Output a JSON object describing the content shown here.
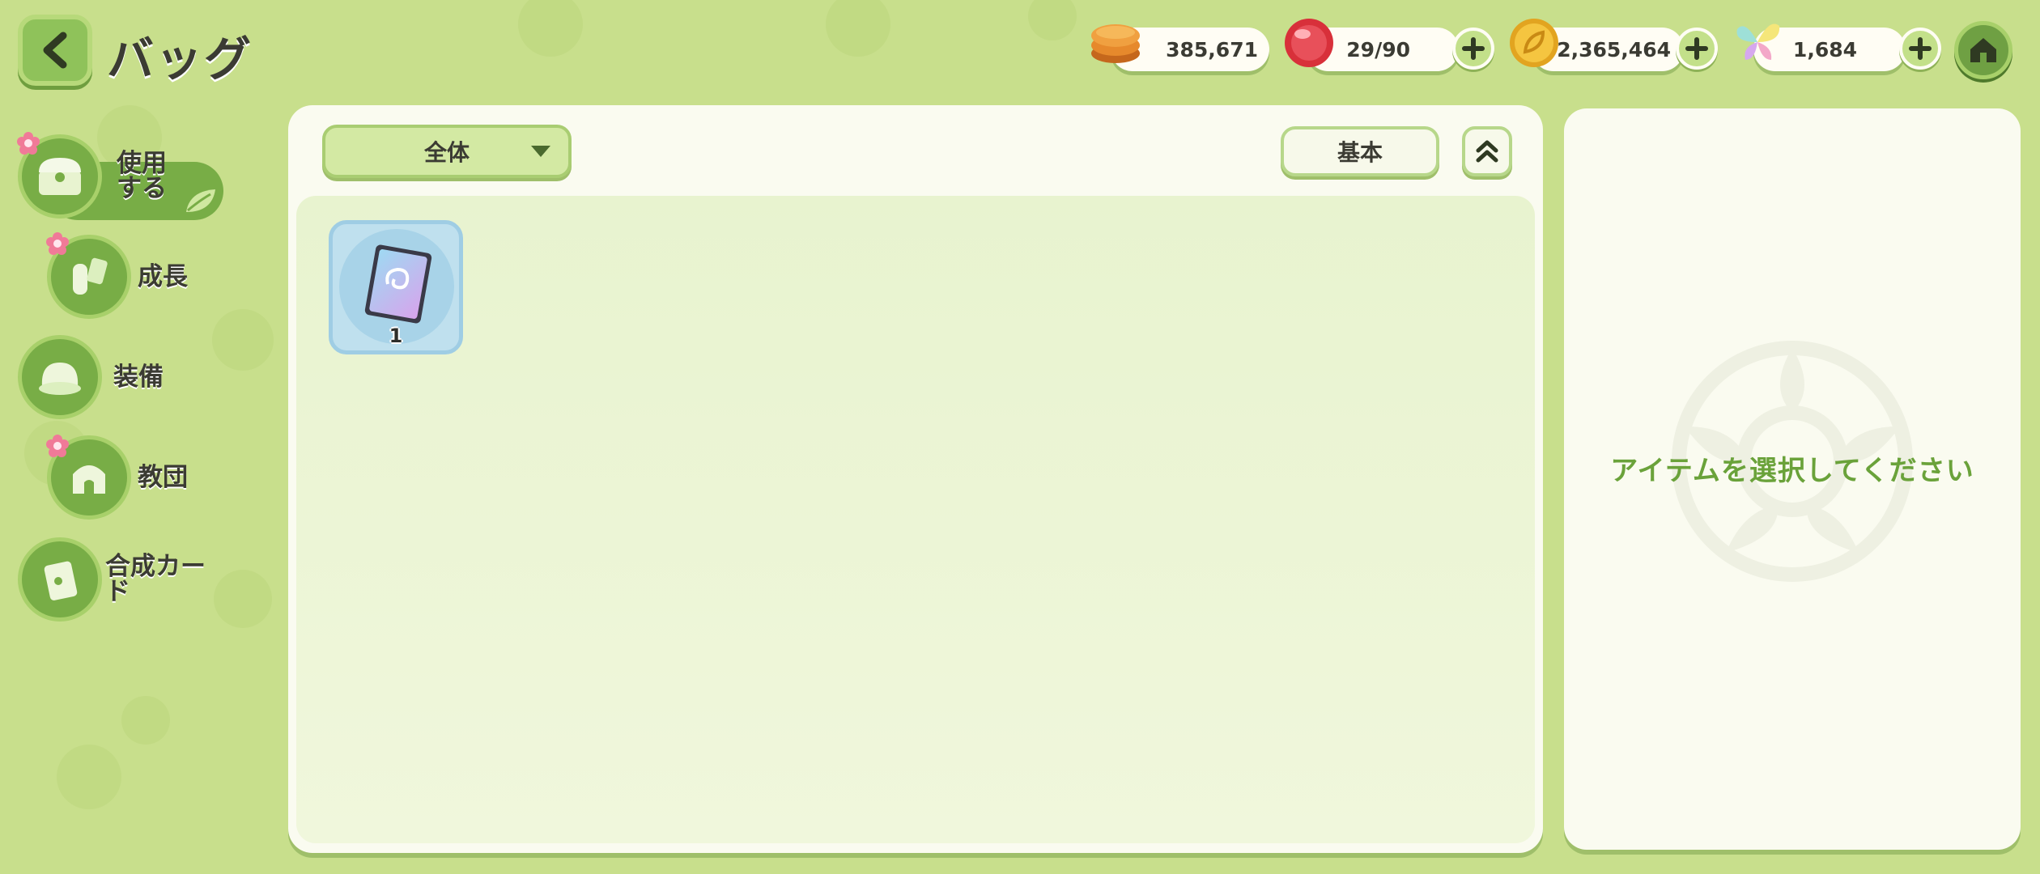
{
  "header": {
    "title": "バッグ",
    "resources": [
      {
        "name": "food",
        "value": "385,671",
        "icon": "pancake-icon",
        "has_plus": false
      },
      {
        "name": "stamina",
        "value": "29/90",
        "icon": "red-orb-icon",
        "has_plus": true
      },
      {
        "name": "gold",
        "value": "2,365,464",
        "icon": "gold-leaf-coin-icon",
        "has_plus": true
      },
      {
        "name": "crystal",
        "value": "1,684",
        "icon": "rainbow-butterfly-icon",
        "has_plus": true
      }
    ]
  },
  "sidebar": {
    "items": [
      {
        "label": "使用する",
        "icon": "treasure-chest-icon",
        "active": true,
        "badge": true
      },
      {
        "label": "成長",
        "icon": "potion-icon",
        "active": false,
        "badge": true
      },
      {
        "label": "装備",
        "icon": "hat-icon",
        "active": false,
        "badge": false
      },
      {
        "label": "教団",
        "icon": "chapel-icon",
        "active": false,
        "badge": true
      },
      {
        "label": "合成カード",
        "icon": "card-icon",
        "active": false,
        "badge": false
      }
    ]
  },
  "main": {
    "filter_label": "全体",
    "sort_label": "基本",
    "items": [
      {
        "icon": "summon-ticket-icon",
        "count": "1"
      }
    ]
  },
  "detail": {
    "empty_text": "アイテムを選択してください"
  },
  "colors": {
    "background": "#c8df8c",
    "panel": "#fafbf0",
    "accent_green": "#78ad46",
    "hint_text": "#6aa23a"
  }
}
